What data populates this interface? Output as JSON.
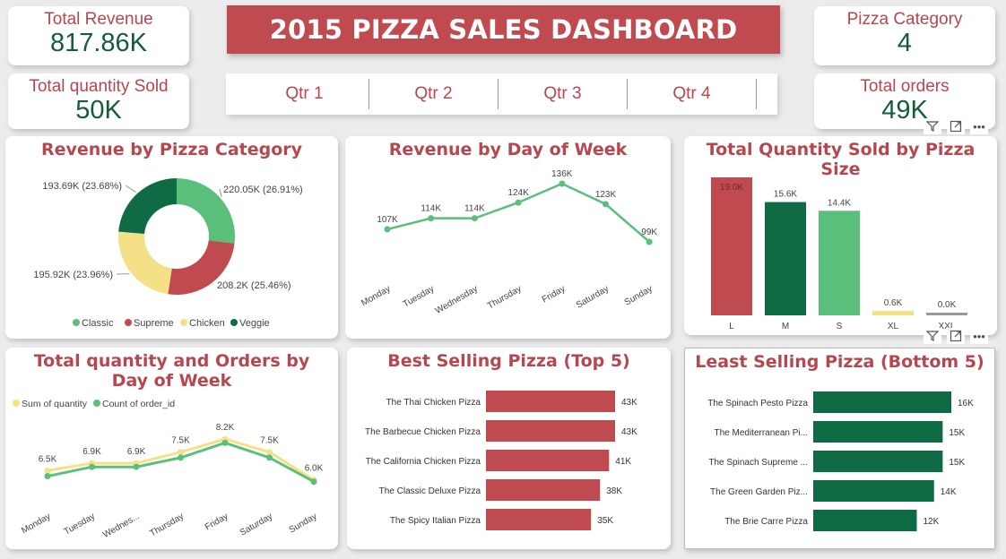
{
  "header": {
    "title": "2015 PIZZA SALES DASHBOARD"
  },
  "kpis": {
    "total_revenue": {
      "label": "Total Revenue",
      "value": "817.86K"
    },
    "total_quantity": {
      "label": "Total quantity Sold",
      "value": "50K"
    },
    "pizza_category": {
      "label": "Pizza Category",
      "value": "4"
    },
    "total_orders": {
      "label": "Total orders",
      "value": "49K"
    }
  },
  "slicer": {
    "items": [
      "Qtr 1",
      "Qtr 2",
      "Qtr 3",
      "Qtr 4"
    ]
  },
  "colors": {
    "red": "#bf4a50",
    "dark_green": "#0e6b44",
    "light_green": "#5bbf7c",
    "yellow": "#f4e087"
  },
  "chart_data": [
    {
      "type": "pie",
      "title": "Revenue by Pizza Category",
      "categories": [
        "Classic",
        "Supreme",
        "Chicken",
        "Veggie"
      ],
      "values": [
        220.05,
        208.2,
        195.92,
        193.69
      ],
      "data_labels": [
        "220.05K (26.91%)",
        "208.2K (25.46%)",
        "195.92K (23.96%)",
        "193.69K (23.68%)"
      ],
      "colors": [
        "#5bbf7c",
        "#bf4a50",
        "#f4e087",
        "#0e6b44"
      ],
      "legend": "bottom"
    },
    {
      "type": "line",
      "title": "Revenue by Day of Week",
      "categories": [
        "Monday",
        "Tuesday",
        "Wednesday",
        "Thursday",
        "Friday",
        "Saturday",
        "Sunday"
      ],
      "values": [
        107,
        114,
        114,
        124,
        136,
        123,
        99
      ],
      "data_labels": [
        "107K",
        "114K",
        "114K",
        "124K",
        "136K",
        "123K",
        "99K"
      ],
      "color": "#5bbf7c"
    },
    {
      "type": "bar",
      "title": "Total Quantity Sold by Pizza Size",
      "categories": [
        "L",
        "M",
        "S",
        "XL",
        "XXL"
      ],
      "values": [
        19.0,
        15.6,
        14.4,
        0.6,
        0.0
      ],
      "data_labels": [
        "19.0K",
        "15.6K",
        "14.4K",
        "0.6K",
        "0.0K"
      ],
      "colors": [
        "#bf4a50",
        "#0e6b44",
        "#5bbf7c",
        "#f4e087",
        "#999999"
      ]
    },
    {
      "type": "line",
      "title": "Total quantity and Orders by Day of Week",
      "categories": [
        "Monday",
        "Tuesday",
        "Wednes...",
        "Thursday",
        "Friday",
        "Saturday",
        "Sunday"
      ],
      "series": [
        {
          "name": "Sum of quantity",
          "values": [
            6.5,
            6.9,
            6.9,
            7.5,
            8.2,
            7.5,
            6.0
          ],
          "color": "#f4e087"
        },
        {
          "name": "Count of order_id",
          "values": [
            6.2,
            6.7,
            6.7,
            7.2,
            8.0,
            7.2,
            5.9
          ],
          "color": "#5bbf7c"
        }
      ],
      "data_labels": [
        "6.5K",
        "6.9K",
        "6.9K",
        "7.5K",
        "8.2K",
        "7.5K",
        "6.0K"
      ],
      "legend": "top-left"
    },
    {
      "type": "bar",
      "title": "Best Selling Pizza (Top 5)",
      "categories": [
        "The Thai Chicken Pizza",
        "The Barbecue Chicken Pizza",
        "The California Chicken Pizza",
        "The Classic Deluxe Pizza",
        "The Spicy Italian Pizza"
      ],
      "values": [
        43,
        43,
        41,
        38,
        35
      ],
      "data_labels": [
        "43K",
        "43K",
        "41K",
        "38K",
        "35K"
      ],
      "color": "#bf4a50"
    },
    {
      "type": "bar",
      "title": "Least Selling Pizza (Bottom 5)",
      "categories": [
        "The Spinach Pesto Pizza",
        "The Mediterranean Pi...",
        "The Spinach Supreme ...",
        "The Green Garden Piz...",
        "The Brie Carre Pizza"
      ],
      "values": [
        16,
        15,
        15,
        14,
        12
      ],
      "data_labels": [
        "16K",
        "15K",
        "15K",
        "14K",
        "12K"
      ],
      "color": "#0e6b44"
    }
  ]
}
